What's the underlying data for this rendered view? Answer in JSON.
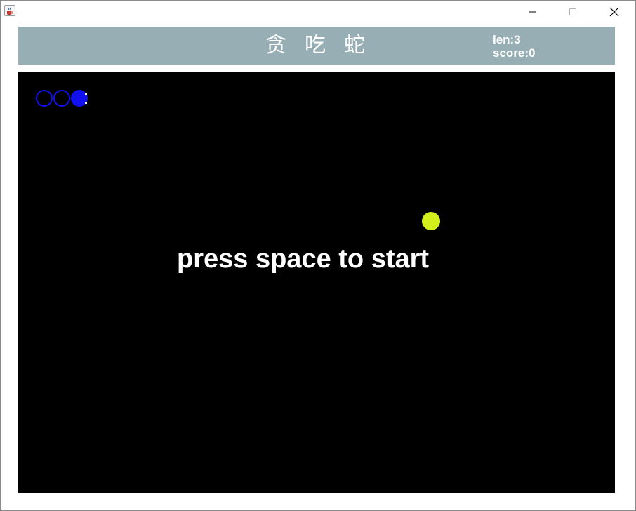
{
  "window": {
    "title": "",
    "controls": [
      "minimize",
      "maximize",
      "close"
    ]
  },
  "header": {
    "title": "贪吃蛇",
    "len_text": "len:3",
    "score_text": "score:0"
  },
  "game": {
    "snake_length": 3,
    "score": 0,
    "snake_direction": "right",
    "prompt": "press space to start"
  },
  "colors": {
    "header_bg": "#96aeb4",
    "board_bg": "#000000",
    "snake": "#1010f0",
    "food": "#d4f01c",
    "text": "#ffffff"
  }
}
